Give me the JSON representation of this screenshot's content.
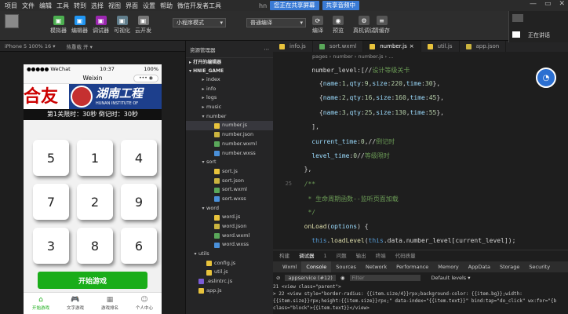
{
  "menubar": {
    "items": [
      "项目",
      "文件",
      "编辑",
      "工具",
      "转到",
      "选择",
      "视图",
      "界面",
      "设置",
      "帮助",
      "微信开发者工具"
    ],
    "user": "hn",
    "banner": [
      "您正在共享屏幕",
      "共享音频中"
    ],
    "controls": [
      "—",
      "▭",
      "✕"
    ]
  },
  "toolbar": {
    "buttons": [
      "模拟器",
      "编辑器",
      "调试器",
      "可视化",
      "云开发"
    ],
    "mode_select": "小程序模式",
    "compile_select": "普通编译",
    "right_buttons": [
      "编译",
      "预览",
      "真机调试",
      "清缓存"
    ]
  },
  "device_bar": {
    "device": "iPhone 5 100% 16 ▾",
    "hot": "热重载 开 ▾"
  },
  "phone": {
    "carrier": "●●●●● WeChat",
    "time": "10:37",
    "battery": "100%",
    "title": "Weixin",
    "capsule": "••• ◉",
    "banner_left": "合友",
    "banner_name": "湖南工程",
    "banner_eng": "HUNAN INSTITUTE OF",
    "timer": "第1关限时：30秒 倒记时：30秒",
    "tiles": [
      "5",
      "1",
      "4",
      "7",
      "2",
      "9",
      "3",
      "8",
      "6"
    ],
    "start": "开始游戏",
    "tabs": [
      {
        "label": "开始游戏",
        "icon": "⌂"
      },
      {
        "label": "文字游戏",
        "icon": "🎮"
      },
      {
        "label": "游戏排名",
        "icon": "▦"
      },
      {
        "label": "个人中心",
        "icon": "☺"
      }
    ]
  },
  "explorer": {
    "title": "资源管理器",
    "open_editors": "打开的编辑器",
    "project": "HNIE_GAME",
    "tree": [
      {
        "name": "index",
        "type": "folder",
        "depth": 1
      },
      {
        "name": "info",
        "type": "folder",
        "depth": 1
      },
      {
        "name": "logs",
        "type": "folder",
        "depth": 1
      },
      {
        "name": "music",
        "type": "folder",
        "depth": 1
      },
      {
        "name": "number",
        "type": "folder-open",
        "depth": 1
      },
      {
        "name": "number.js",
        "type": "js",
        "depth": 2,
        "selected": true
      },
      {
        "name": "number.json",
        "type": "json",
        "depth": 2
      },
      {
        "name": "number.wxml",
        "type": "wxml",
        "depth": 2
      },
      {
        "name": "number.wxss",
        "type": "wxss",
        "depth": 2
      },
      {
        "name": "sort",
        "type": "folder-open",
        "depth": 1
      },
      {
        "name": "sort.js",
        "type": "js",
        "depth": 2
      },
      {
        "name": "sort.json",
        "type": "json",
        "depth": 2
      },
      {
        "name": "sort.wxml",
        "type": "wxml",
        "depth": 2
      },
      {
        "name": "sort.wxss",
        "type": "wxss",
        "depth": 2
      },
      {
        "name": "word",
        "type": "folder-open",
        "depth": 1
      },
      {
        "name": "word.js",
        "type": "js",
        "depth": 2
      },
      {
        "name": "word.json",
        "type": "json",
        "depth": 2
      },
      {
        "name": "word.wxml",
        "type": "wxml",
        "depth": 2
      },
      {
        "name": "word.wxss",
        "type": "wxss",
        "depth": 2
      },
      {
        "name": "utils",
        "type": "folder-open",
        "depth": 0
      },
      {
        "name": "config.js",
        "type": "js",
        "depth": 1
      },
      {
        "name": "util.js",
        "type": "js",
        "depth": 1
      },
      {
        "name": ".eslintrc.js",
        "type": "eslint",
        "depth": 0
      },
      {
        "name": "app.js",
        "type": "js",
        "depth": 0
      }
    ]
  },
  "editor": {
    "tabs": [
      "info.js",
      "sort.wxml",
      "number.js",
      "util.js",
      "app.json"
    ],
    "active_tab": "number.js",
    "breadcrumb": "pages › number › number.js › ...",
    "lines": [
      {
        "n": "",
        "t": [
          [
            "p",
            "    number_level:[//"
          ],
          [
            "c",
            "设计等级关卡"
          ]
        ]
      },
      {
        "n": "",
        "t": [
          [
            "p",
            "      {"
          ],
          [
            "k",
            "name"
          ],
          [
            "p",
            ":"
          ],
          [
            "n",
            "1"
          ],
          [
            "p",
            ","
          ],
          [
            "k",
            "qty"
          ],
          [
            "p",
            ":"
          ],
          [
            "n",
            "9"
          ],
          [
            "p",
            ","
          ],
          [
            "k",
            "size"
          ],
          [
            "p",
            ":"
          ],
          [
            "n",
            "220"
          ],
          [
            "p",
            ","
          ],
          [
            "k",
            "time"
          ],
          [
            "p",
            ":"
          ],
          [
            "n",
            "30"
          ],
          [
            "p",
            "},"
          ]
        ]
      },
      {
        "n": "",
        "t": [
          [
            "p",
            "      {"
          ],
          [
            "k",
            "name"
          ],
          [
            "p",
            ":"
          ],
          [
            "n",
            "2"
          ],
          [
            "p",
            ","
          ],
          [
            "k",
            "qty"
          ],
          [
            "p",
            ":"
          ],
          [
            "n",
            "16"
          ],
          [
            "p",
            ","
          ],
          [
            "k",
            "size"
          ],
          [
            "p",
            ":"
          ],
          [
            "n",
            "160"
          ],
          [
            "p",
            ","
          ],
          [
            "k",
            "time"
          ],
          [
            "p",
            ":"
          ],
          [
            "n",
            "45"
          ],
          [
            "p",
            "},"
          ]
        ]
      },
      {
        "n": "",
        "t": [
          [
            "p",
            "      {"
          ],
          [
            "k",
            "name"
          ],
          [
            "p",
            ":"
          ],
          [
            "n",
            "3"
          ],
          [
            "p",
            ","
          ],
          [
            "k",
            "qty"
          ],
          [
            "p",
            ":"
          ],
          [
            "n",
            "25"
          ],
          [
            "p",
            ","
          ],
          [
            "k",
            "size"
          ],
          [
            "p",
            ":"
          ],
          [
            "n",
            "130"
          ],
          [
            "p",
            ","
          ],
          [
            "k",
            "time"
          ],
          [
            "p",
            ":"
          ],
          [
            "n",
            "55"
          ],
          [
            "p",
            "},"
          ]
        ]
      },
      {
        "n": "",
        "t": [
          [
            "p",
            "    ],"
          ]
        ]
      },
      {
        "n": "",
        "t": [
          [
            "k",
            "    current_time"
          ],
          [
            "p",
            ":"
          ],
          [
            "n",
            "0"
          ],
          [
            "p",
            ",//"
          ],
          [
            "c",
            "倒记时"
          ]
        ]
      },
      {
        "n": "",
        "t": [
          [
            "k",
            "    level_time"
          ],
          [
            "p",
            ":"
          ],
          [
            "n",
            "0"
          ],
          [
            "p",
            "//"
          ],
          [
            "c",
            "等级限时"
          ]
        ]
      },
      {
        "n": "",
        "t": [
          [
            "p",
            "  },"
          ]
        ]
      },
      {
        "n": "25",
        "t": [
          [
            "c",
            "  /**"
          ]
        ]
      },
      {
        "n": "",
        "t": [
          [
            "c",
            "   * 生命周期函数--监听页面加载"
          ]
        ]
      },
      {
        "n": "",
        "t": [
          [
            "c",
            "   */"
          ]
        ]
      },
      {
        "n": "",
        "t": [
          [
            "f",
            "  onLoad"
          ],
          [
            "p",
            "("
          ],
          [
            "k",
            "options"
          ],
          [
            "p",
            ") {"
          ]
        ]
      },
      {
        "n": "",
        "t": [
          [
            "b",
            "    this"
          ],
          [
            "p",
            "."
          ],
          [
            "f",
            "loadLevel"
          ],
          [
            "p",
            "("
          ],
          [
            "b",
            "this"
          ],
          [
            "p",
            ".data.number_level[current_level]);"
          ]
        ]
      }
    ]
  },
  "panel": {
    "tabs": [
      "构建",
      "调试器",
      "1",
      "问题",
      "输出",
      "终端",
      "代码质量"
    ],
    "console_tabs": [
      "Wxml",
      "Console",
      "Sources",
      "Network",
      "Performance",
      "Memory",
      "AppData",
      "Storage",
      "Security"
    ],
    "context": "appservice (#12)",
    "filter": "Filter",
    "levels": "Default levels ▾",
    "lines": [
      "21      <view class=\"parent\">",
      "> 22      <view style=\"border-radius: {{item.size/4}}rpx;background-color: {{item.bg}};width:",
      "  {{item.size}}rpx;height:{{item.size}}rpx;\" data-index=\"{{item.text}}\" bind:tap=\"do_click\" wx:for=\"{b",
      "  class=\"block\">{{item.text}}</view>"
    ]
  },
  "rightwin": {
    "label": "正在讲话"
  },
  "colors": {
    "accent": "#1aad19",
    "blue": "#3a7bd5"
  }
}
